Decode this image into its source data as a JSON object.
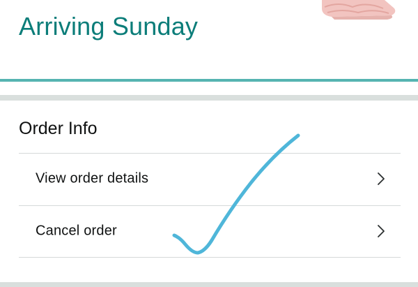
{
  "delivery": {
    "status_text": "Arriving Sunday",
    "product_image": "pink-blanket-thumbnail"
  },
  "order_info": {
    "title": "Order Info",
    "items": [
      {
        "label": "View order details",
        "icon": "chevron-right-icon"
      },
      {
        "label": "Cancel order",
        "icon": "chevron-right-icon"
      }
    ]
  },
  "annotation": {
    "mark": "handwritten-checkmark",
    "color": "#4fb6d9"
  },
  "colors": {
    "accent_teal": "#0b7d79",
    "rule_teal": "#56b4b1",
    "band_gray": "#d9dfdd",
    "text": "#0f1111"
  }
}
